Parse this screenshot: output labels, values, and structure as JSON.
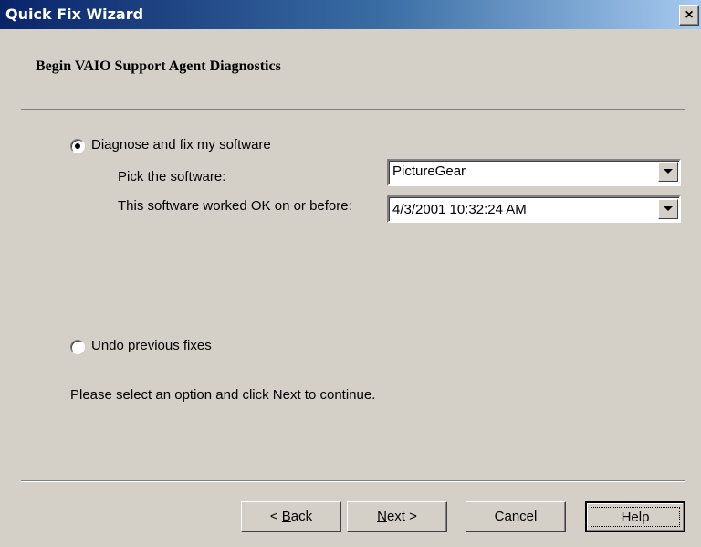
{
  "window": {
    "title": "Quick Fix Wizard",
    "close_label": "×"
  },
  "page": {
    "heading": "Begin VAIO Support Agent Diagnostics"
  },
  "options": {
    "diagnose": {
      "label": "Diagnose and fix my software",
      "selected": true
    },
    "undo": {
      "label": "Undo previous fixes",
      "selected": false
    }
  },
  "form": {
    "software_label": "Pick the software:",
    "software_value": "PictureGear",
    "date_label": "This software worked OK on or before:",
    "date_value": "4/3/2001 10:32:24 AM"
  },
  "instruction": "Please select an option  and click Next to continue.",
  "buttons": {
    "back": {
      "accel": "B",
      "rest": "ack",
      "prefix": "< "
    },
    "next": {
      "accel": "N",
      "rest": "ext",
      "suffix": " >"
    },
    "cancel": "Cancel",
    "help": "Help"
  }
}
